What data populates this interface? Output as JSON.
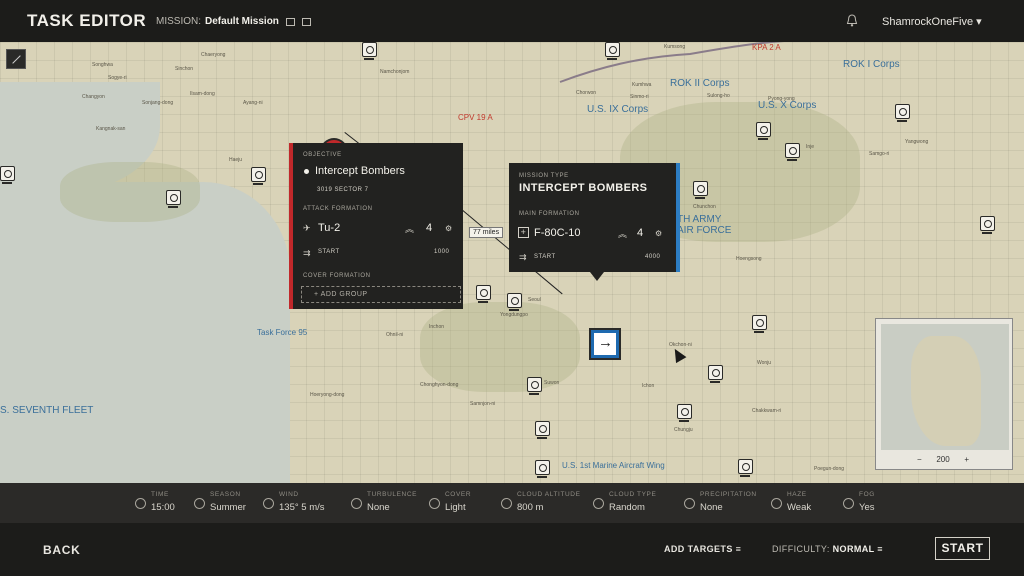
{
  "header": {
    "title": "TASK EDITOR",
    "mission_label": "MISSION:",
    "mission_name": "Default Mission",
    "user": "ShamrockOneFive ▾"
  },
  "map": {
    "labels_blue": [
      "ROK I Corps",
      "ROK II Corps",
      "U.S. IX Corps",
      "U.S. X Corps",
      "TH ARMY",
      "AIR FORCE",
      "Task Force 95",
      "S. SEVENTH FLEET",
      "U.S. 1st Marine Aircraft Wing"
    ],
    "labels_red": [
      "KPA 2 A",
      "CPV 19 A"
    ],
    "towns": [
      "Songhwa",
      "Sinchon",
      "Chaeryong",
      "Namchonjom",
      "Kumsong",
      "Sogye-ri",
      "Changyon",
      "Sonjang-dong",
      "Ilsam-dong",
      "Ayang-ni",
      "Kangnak-san",
      "Haeju",
      "Chorwon",
      "Kumhwa",
      "Sinmo-ri",
      "Pyong-yong",
      "Sulong-ho",
      "Inje",
      "Samgo-ri",
      "Yangwong",
      "Chunchon",
      "Seoul",
      "Yongdungpo",
      "Inchon",
      "Suwon",
      "Ichon",
      "Wonju",
      "Chungju",
      "Poegun-dong",
      "Okchon-ni",
      "Chakkwam-ri",
      "Hoengsong",
      "Samnjon-ni",
      "Ohnil-ni",
      "Hoeryong-dong",
      "Chonghyon-dong"
    ],
    "distance_label": "77 miles",
    "minimap_zoom": "200"
  },
  "objective_panel": {
    "section": "OBJECTIVE",
    "name": "Intercept Bombers",
    "location": "3019 SECTOR 7",
    "attack_label": "ATTACK FORMATION",
    "aircraft": "Tu-2",
    "count": "4",
    "start_label": "START",
    "start_alt": "1000",
    "cover_label": "COVER FORMATION",
    "add_group": "+ ADD GROUP"
  },
  "mission_panel": {
    "section": "MISSION TYPE",
    "type": "INTERCEPT BOMBERS",
    "main_label": "MAIN FORMATION",
    "aircraft": "F-80C-10",
    "count": "4",
    "start_label": "START",
    "start_alt": "4000"
  },
  "weather": [
    {
      "key": "TIME",
      "value": "15:00"
    },
    {
      "key": "SEASON",
      "value": "Summer"
    },
    {
      "key": "WIND",
      "value": "135° 5 m/s"
    },
    {
      "key": "TURBULENCE",
      "value": "None"
    },
    {
      "key": "COVER",
      "value": "Light"
    },
    {
      "key": "CLOUD ALTITUDE",
      "value": "800 m"
    },
    {
      "key": "CLOUD TYPE",
      "value": "Random"
    },
    {
      "key": "PRECIPITATION",
      "value": "None"
    },
    {
      "key": "HAZE",
      "value": "Weak"
    },
    {
      "key": "FOG",
      "value": "Yes"
    }
  ],
  "bottom": {
    "back": "BACK",
    "add_targets": "ADD TARGETS ≡",
    "difficulty_label": "DIFFICULTY:",
    "difficulty_value": "NORMAL ≡",
    "start": "START"
  }
}
